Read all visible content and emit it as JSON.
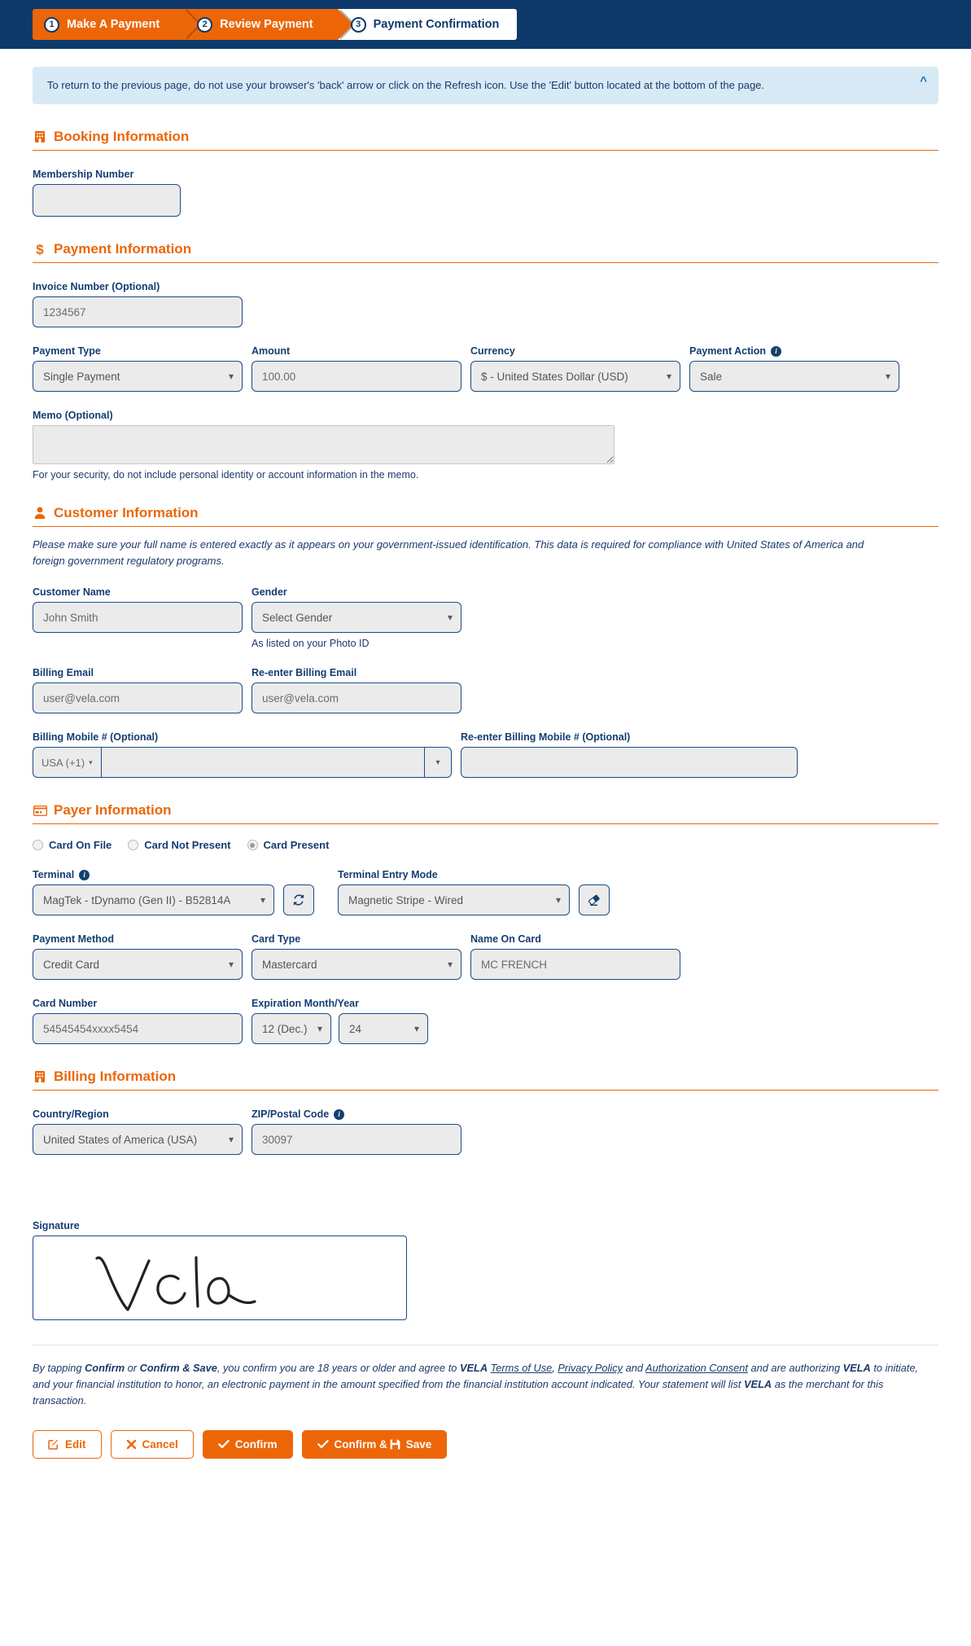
{
  "steps": [
    {
      "num": "1",
      "label": "Make A Payment",
      "state": "done"
    },
    {
      "num": "2",
      "label": "Review Payment",
      "state": "done"
    },
    {
      "num": "3",
      "label": "Payment Confirmation",
      "state": "current"
    }
  ],
  "alert": {
    "text": "To return to the previous page, do not use your browser's 'back' arrow or click on the Refresh icon. Use the 'Edit' button located at the bottom of the page.",
    "collapse_icon": "chevron-up-icon"
  },
  "booking": {
    "heading": "Booking Information",
    "heading_icon": "building-icon",
    "membership_label": "Membership Number",
    "membership_value": ""
  },
  "payment": {
    "heading": "Payment Information",
    "heading_icon": "dollar-sign-icon",
    "invoice_label": "Invoice Number (Optional)",
    "invoice_value": "1234567",
    "payment_type_label": "Payment Type",
    "payment_type_value": "Single Payment",
    "amount_label": "Amount",
    "amount_value": "100.00",
    "currency_label": "Currency",
    "currency_value": "$ - United States Dollar (USD)",
    "payment_action_label": "Payment Action",
    "payment_action_info_icon": "info-icon",
    "payment_action_value": "Sale",
    "memo_label": "Memo (Optional)",
    "memo_value": "",
    "memo_hint": "For your security, do not include personal identity or account information in the memo."
  },
  "customer": {
    "heading": "Customer Information",
    "heading_icon": "person-icon",
    "notice": "Please make sure your full name is entered exactly as it appears on your government-issued identification. This data is required for compliance with United States of America and foreign government regulatory programs.",
    "name_label": "Customer Name",
    "name_value": "John Smith",
    "gender_label": "Gender",
    "gender_value": "Select Gender",
    "gender_hint": "As listed on your Photo ID",
    "email_label": "Billing Email",
    "email_value": "user@vela.com",
    "email_confirm_label": "Re-enter Billing Email",
    "email_confirm_value": "user@vela.com",
    "mobile_label": "Billing Mobile # (Optional)",
    "mobile_country": "USA (+1)",
    "mobile_value": "",
    "mobile_confirm_label": "Re-enter Billing Mobile # (Optional)",
    "mobile_confirm_value": ""
  },
  "payer": {
    "heading": "Payer Information",
    "heading_icon": "credit-card-icon",
    "options": [
      {
        "label": "Card On File",
        "selected": false
      },
      {
        "label": "Card Not Present",
        "selected": false
      },
      {
        "label": "Card Present",
        "selected": true
      }
    ],
    "terminal_label": "Terminal",
    "terminal_info_icon": "info-icon",
    "terminal_value": "MagTek - tDynamo (Gen II) - B52814A",
    "terminal_refresh_icon": "refresh-icon",
    "entry_mode_label": "Terminal Entry Mode",
    "entry_mode_value": "Magnetic Stripe - Wired",
    "entry_mode_clear_icon": "eraser-icon",
    "payment_method_label": "Payment Method",
    "payment_method_value": "Credit Card",
    "card_type_label": "Card Type",
    "card_type_value": "Mastercard",
    "name_on_card_label": "Name On Card",
    "name_on_card_value": "MC FRENCH",
    "card_number_label": "Card Number",
    "card_number_value": "54545454xxxx5454",
    "expiration_label": "Expiration Month/Year",
    "expiration_month": "12 (Dec.)",
    "expiration_year": "24"
  },
  "billing": {
    "heading": "Billing Information",
    "heading_icon": "building-icon",
    "country_label": "Country/Region",
    "country_value": "United States of America (USA)",
    "zip_label": "ZIP/Postal Code",
    "zip_info_icon": "info-icon",
    "zip_value": "30097"
  },
  "signature": {
    "label": "Signature",
    "content": "Vela"
  },
  "legal": {
    "p1_a": "By tapping ",
    "p1_confirm": "Confirm",
    "p1_b": " or ",
    "p1_confirm_save": "Confirm & Save",
    "p1_c": ", you confirm you are 18 years or older and agree to ",
    "brand1": "VELA",
    "link_terms": "Terms of Use",
    "sep1": ", ",
    "link_privacy": "Privacy Policy",
    "sep2": " and ",
    "link_auth": "Authorization Consent",
    "p1_d": " and are authorizing ",
    "brand2": "VELA",
    "p1_e": " to initiate, and your financial institution to honor, an electronic payment in the amount specified from the financial institution account indicated. Your statement will list ",
    "brand3": "VELA",
    "p1_f": " as the merchant for this transaction."
  },
  "buttons": {
    "edit": "Edit",
    "edit_icon": "pencil-square-icon",
    "cancel": "Cancel",
    "cancel_icon": "x-icon",
    "confirm": "Confirm",
    "confirm_icon": "check-icon",
    "confirm_save": "Confirm & ",
    "confirm_save_icon": "check-icon",
    "save_icon": "floppy-disk-icon",
    "save": "Save"
  },
  "colors": {
    "brand_orange": "#ec6608",
    "brand_navy": "#0d3a6b",
    "alert_bg": "#d7eaf5",
    "field_bg": "#ebebeb"
  }
}
